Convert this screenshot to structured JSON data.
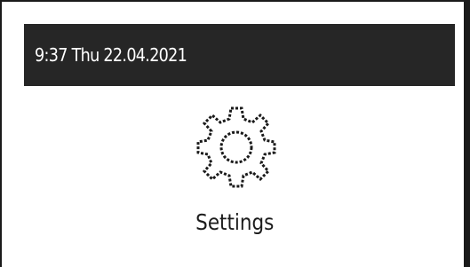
{
  "status_bar": {
    "datetime": "9:37 Thu 22.04.2021"
  },
  "menu": {
    "current_item": {
      "icon": "gear-icon",
      "label": "Settings"
    }
  }
}
